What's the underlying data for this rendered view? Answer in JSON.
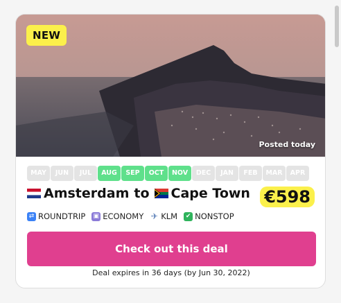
{
  "deal": {
    "badge": "NEW",
    "posted": "Posted today",
    "months": [
      {
        "label": "MAY",
        "active": false
      },
      {
        "label": "JUN",
        "active": false
      },
      {
        "label": "JUL",
        "active": false
      },
      {
        "label": "AUG",
        "active": true
      },
      {
        "label": "SEP",
        "active": true
      },
      {
        "label": "OCT",
        "active": true
      },
      {
        "label": "NOV",
        "active": true
      },
      {
        "label": "DEC",
        "active": false
      },
      {
        "label": "JAN",
        "active": false
      },
      {
        "label": "FEB",
        "active": false
      },
      {
        "label": "MAR",
        "active": false
      },
      {
        "label": "APR",
        "active": false
      }
    ],
    "origin": "Amsterdam",
    "connector": "to",
    "destination": "Cape Town",
    "price": "€598",
    "tags": [
      {
        "icon": "roundtrip-icon",
        "label": "ROUNDTRIP"
      },
      {
        "icon": "seat-icon",
        "label": "ECONOMY"
      },
      {
        "icon": "airplane-icon",
        "label": "KLM"
      },
      {
        "icon": "checkmark-icon",
        "label": "NONSTOP"
      }
    ],
    "cta_label": "Check out this deal",
    "expires": "Deal expires in 36 days (by Jun 30, 2022)"
  },
  "colors": {
    "accent": "#e03f8f",
    "highlight": "#fbf04b",
    "month_active": "#5fe08b",
    "month_inactive": "#e4e4e4"
  }
}
